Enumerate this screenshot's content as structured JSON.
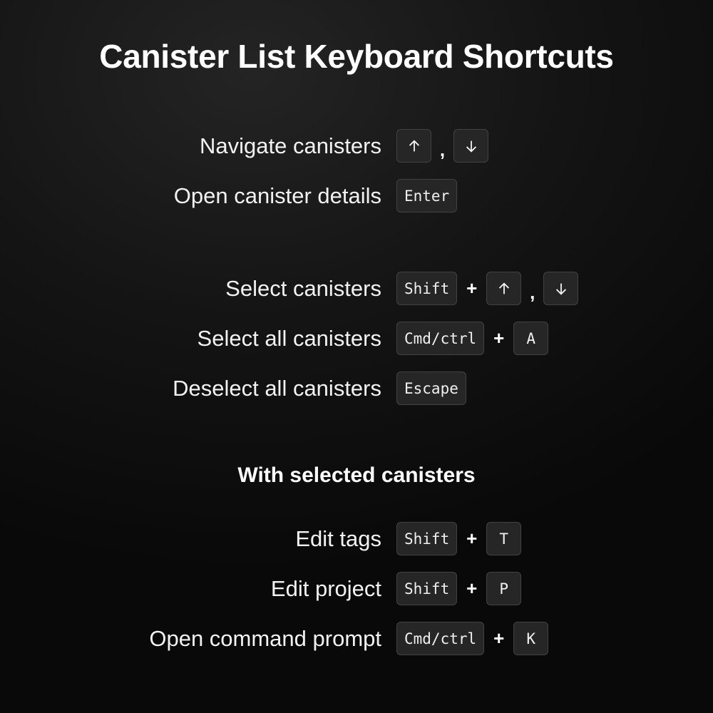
{
  "title": "Canister List Keyboard Shortcuts",
  "groups": {
    "navigation": [
      {
        "label": "Navigate canisters",
        "keys": [
          "arrow-up",
          "arrow-down"
        ],
        "separator": ","
      },
      {
        "label": "Open canister details",
        "keys": [
          "Enter"
        ]
      }
    ],
    "selection": [
      {
        "label": "Select canisters",
        "keys": [
          "Shift",
          "arrow-up",
          "arrow-down"
        ],
        "separators": [
          "+",
          ","
        ]
      },
      {
        "label": "Select all canisters",
        "keys": [
          "Cmd/ctrl",
          "A"
        ],
        "separator": "+"
      },
      {
        "label": "Deselect all canisters",
        "keys": [
          "Escape"
        ]
      }
    ],
    "with_selected": {
      "heading": "With selected canisters",
      "items": [
        {
          "label": "Edit tags",
          "keys": [
            "Shift",
            "T"
          ],
          "separator": "+"
        },
        {
          "label": "Edit project",
          "keys": [
            "Shift",
            "P"
          ],
          "separator": "+"
        },
        {
          "label": "Open command prompt",
          "keys": [
            "Cmd/ctrl",
            "K"
          ],
          "separator": "+"
        }
      ]
    }
  },
  "symbols": {
    "plus": "+",
    "comma": ","
  },
  "colors": {
    "key_bg": "#262626",
    "key_border": "#424242",
    "text": "#ffffff"
  }
}
